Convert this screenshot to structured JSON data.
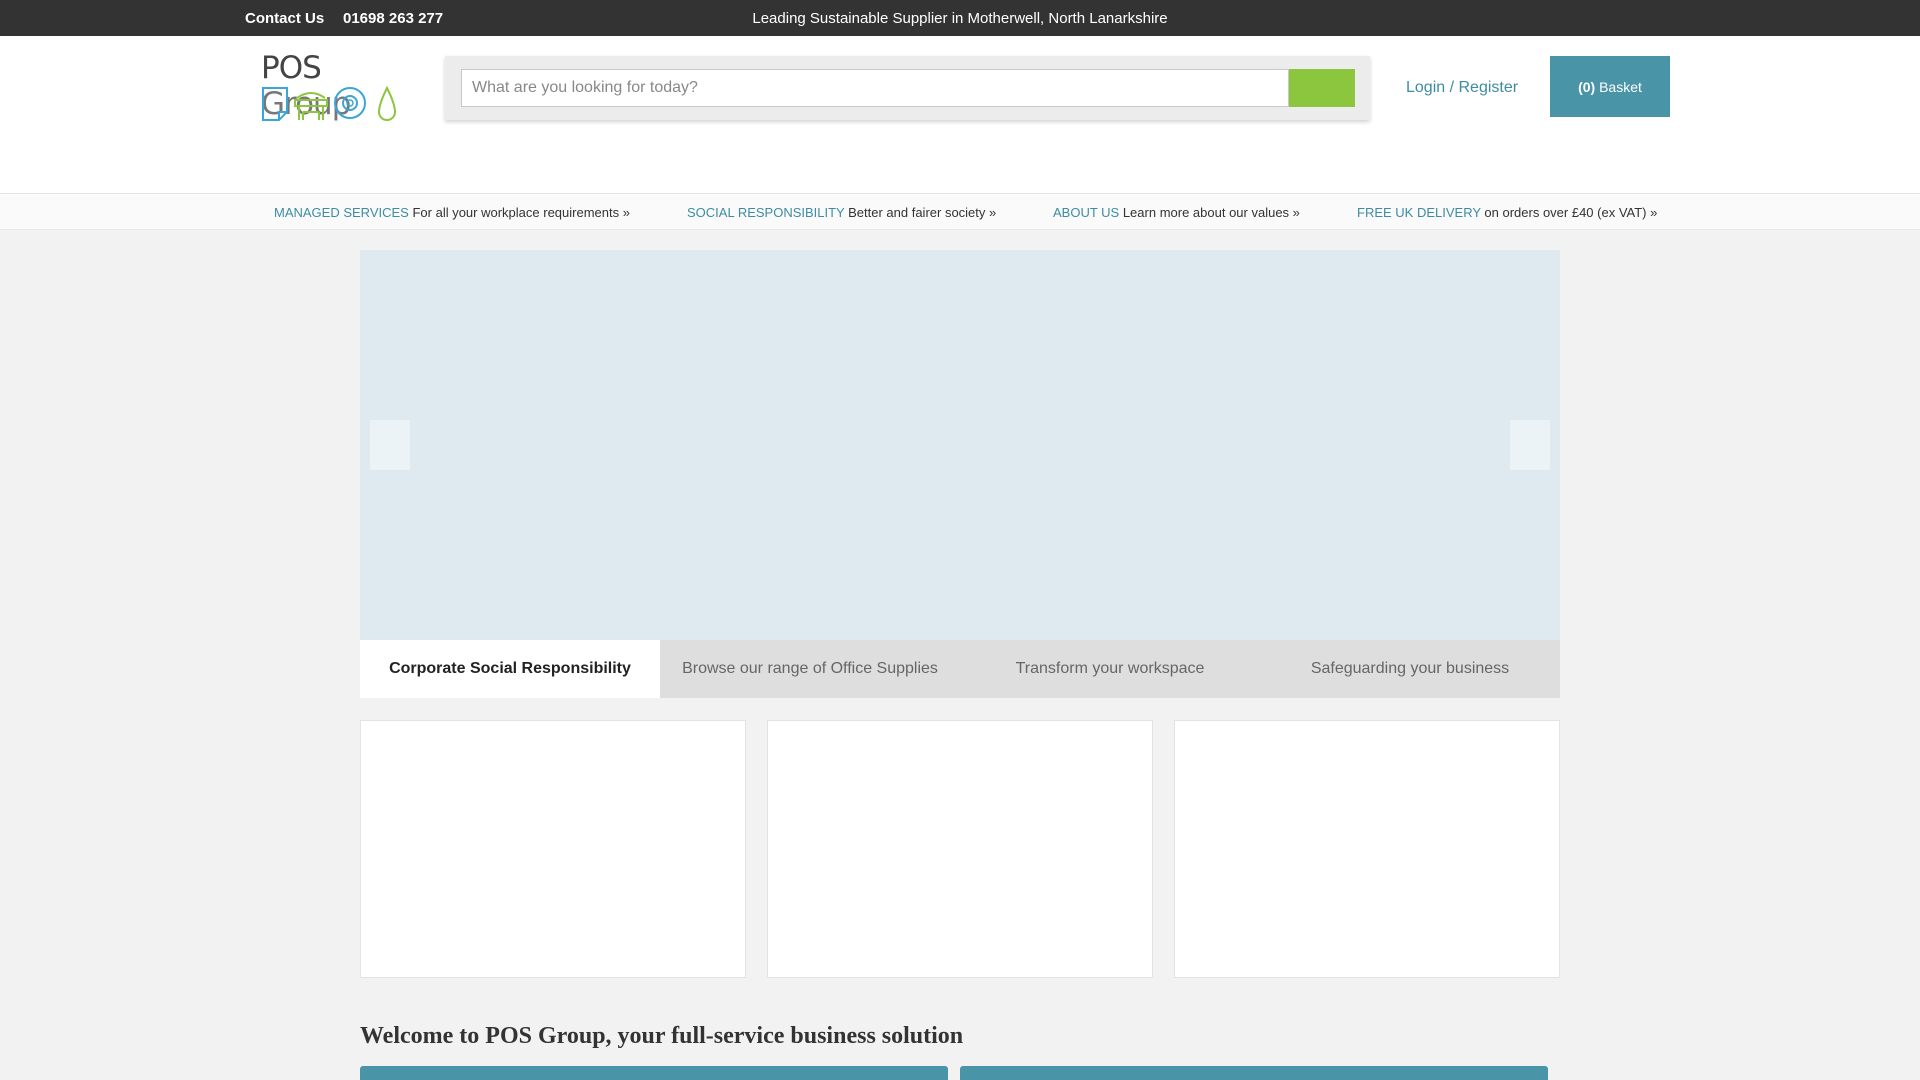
{
  "topbar": {
    "contact_label": "Contact Us",
    "phone": "01698 263 277",
    "tagline": "Leading Sustainable Supplier in Motherwell, North Lanarkshire"
  },
  "header": {
    "logo_brand": "POS",
    "logo_group": "Group",
    "search_placeholder": "What are you looking for today?",
    "search_icon": "search-icon",
    "login_label": "Login / Register",
    "basket_count": "(0)",
    "basket_label": "Basket"
  },
  "usp": [
    {
      "highlight": "Managed Services",
      "text": " For all your workplace requirements »"
    },
    {
      "highlight": "Social Responsibility",
      "text": " Better and fairer society »"
    },
    {
      "highlight": "About Us",
      "text": " Learn more about our values »"
    },
    {
      "highlight": "Free UK Delivery",
      "text": " on orders over £40 (ex VAT) »"
    }
  ],
  "hero": {
    "tabs": [
      "Corporate Social Responsibility",
      "Browse our range of Office Supplies",
      "Transform your workspace",
      "Safeguarding your business"
    ],
    "active_tab": 0
  },
  "welcome_heading": "Welcome to POS Group, your full-service business solution",
  "colors": {
    "topbar": "#333333",
    "accent_teal": "#4a94a8",
    "link_teal": "#3d8ca3",
    "search_green": "#8cc63f",
    "hero_bg": "#dfeaf0",
    "page_bg": "#f2f2f2"
  }
}
